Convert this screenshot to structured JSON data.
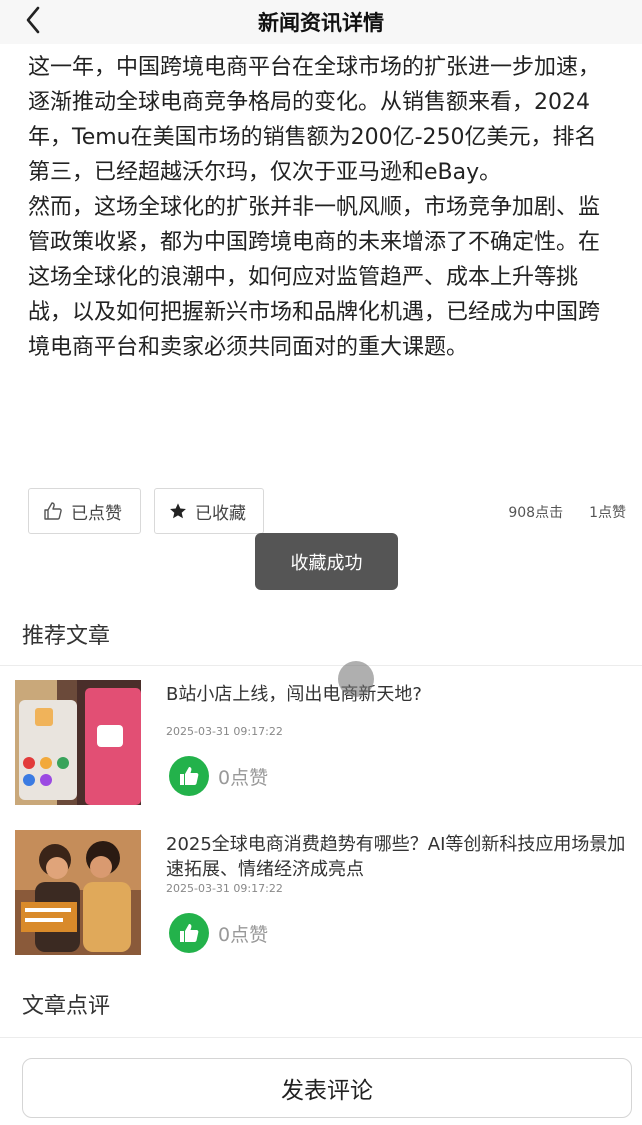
{
  "header": {
    "title": "新闻资讯详情",
    "back_icon": "chevron-left-icon"
  },
  "article": {
    "paragraphs": [
      "这一年，中国跨境电商平台在全球市场的扩张进一步加速，逐渐推动全球电商竞争格局的变化。从销售额来看，2024年，Temu在美国市场的销售额为200亿-250亿美元，排名第三，已经超越沃尔玛，仅次于亚马逊和eBay。",
      "然而，这场全球化的扩张并非一帆风顺，市场竞争加剧、监管政策收紧，都为中国跨境电商的未来增添了不确定性。在这场全球化的浪潮中，如何应对监管趋严、成本上升等挑战，以及如何把握新兴市场和品牌化机遇，已经成为中国跨境电商平台和卖家必须共同面对的重大课题。"
    ]
  },
  "actions": {
    "like_label": "已点赞",
    "favorite_label": "已收藏",
    "clicks": "908点击",
    "likes": "1点赞"
  },
  "toast": {
    "message": "收藏成功"
  },
  "recommend": {
    "title": "推荐文章",
    "items": [
      {
        "headline": "B站小店上线，闯出电商新天地?",
        "date": "2025-03-31 09:17:22",
        "likes": "0点赞"
      },
      {
        "headline": "2025全球电商消费趋势有哪些？AI等创新科技应用场景加速拓展、情绪经济成亮点",
        "date": "2025-03-31 09:17:22",
        "likes": "0点赞"
      }
    ]
  },
  "comments": {
    "title": "文章点评",
    "post_button": "发表评论"
  },
  "colors": {
    "header_bg": "#f7f7f7",
    "like_green": "#23b24b",
    "toast_bg": "#555555"
  }
}
